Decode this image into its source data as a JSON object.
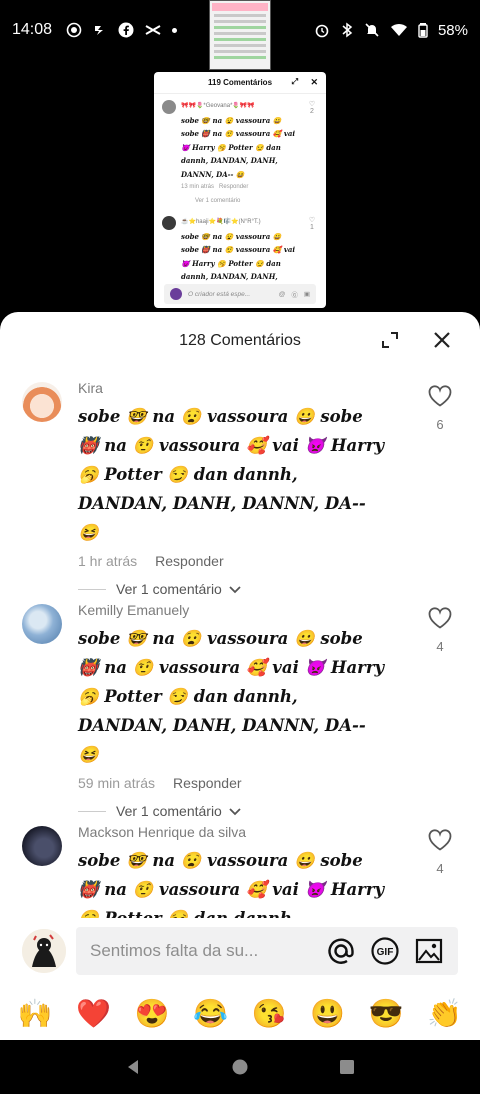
{
  "status": {
    "time": "14:08",
    "battery": "58%"
  },
  "mini_window": {
    "title": "119 Comentários",
    "comments": [
      {
        "name": "🎀🎀🌷*Geovana*🌷🎀🎀",
        "text": "sobe 🤓 na 😧 vassoura 😀 sobe 👹 na 🤨 vassoura 🥰 vai 👿 Harry 🥱 Potter 😏 dan dannh, DANDAN, DANH, DANNN, DA-- 😆",
        "meta_time": "13 min atrás",
        "meta_reply": "Responder",
        "view": "Ver 1 comentário",
        "likes": "2"
      },
      {
        "name": "☕⭐haaji⭐💐🎼⭐(N°R°T.)",
        "text": "sobe 🤓 na 😧 vassoura 😀 sobe 👹 na 🤨 vassoura 🥰 vai 👿 Harry 🥱 Potter 😏 dan dannh, DANDAN, DANH, DANNN, DA--",
        "likes": "1"
      }
    ],
    "input_placeholder": "O criador está espe..."
  },
  "sheet": {
    "title": "128 Comentários"
  },
  "comments": [
    {
      "name": "Kira",
      "text": "sobe 🤓 na 😧 vassoura 😀 sobe 👹 na 🤨 vassoura 🥰 vai 👿 Harry 🥱 Potter 😏 dan dannh, DANDAN, DANH, DANNN, DA-- 😆",
      "time": "1 hr atrás",
      "reply": "Responder",
      "view": "Ver 1 comentário",
      "likes": "6"
    },
    {
      "name": "Kemilly Emanuely",
      "text": "sobe 🤓 na 😧 vassoura 😀 sobe 👹 na 🤨 vassoura 🥰 vai 👿 Harry 🥱 Potter 😏 dan dannh, DANDAN, DANH, DANNN, DA-- 😆",
      "time": "59 min atrás",
      "reply": "Responder",
      "view": "Ver 1 comentário",
      "likes": "4"
    },
    {
      "name": "Mackson Henrique da silva",
      "text": "sobe 🤓 na 😧 vassoura 😀 sobe 👹 na 🤨 vassoura 🥰 vai 👿 Harry 🥱 Potter 😏 dan dannh, DANDAN, DANH, DANNN,",
      "likes": "4"
    }
  ],
  "composer": {
    "placeholder": "Sentimos falta da su..."
  },
  "emojis": [
    "🙌",
    "❤️",
    "😍",
    "😂",
    "😘",
    "😃",
    "😎",
    "👏"
  ],
  "icons": {
    "heart": "heart-outline-icon",
    "expand": "expand-icon",
    "close": "close-icon",
    "mention": "at-icon",
    "gif": "gif-icon",
    "image": "image-icon"
  }
}
